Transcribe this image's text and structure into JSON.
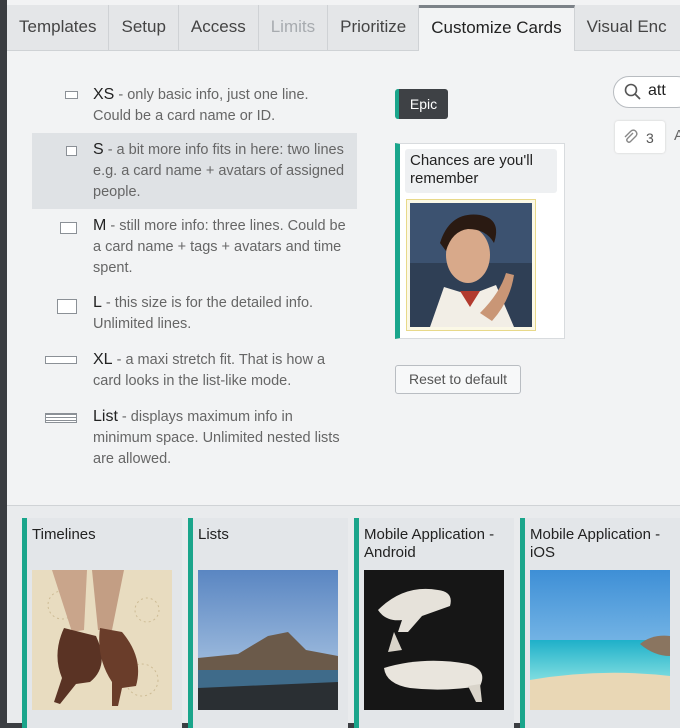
{
  "tabs": [
    {
      "label": "Templates",
      "state": "normal"
    },
    {
      "label": "Setup",
      "state": "normal"
    },
    {
      "label": "Access",
      "state": "normal"
    },
    {
      "label": "Limits",
      "state": "disabled"
    },
    {
      "label": "Prioritize",
      "state": "normal"
    },
    {
      "label": "Customize Cards",
      "state": "active"
    },
    {
      "label": "Visual Enc",
      "state": "normal"
    }
  ],
  "sizes": [
    {
      "code": "XS",
      "desc": " - only basic info, just one line. Could be a card name or ID."
    },
    {
      "code": "S",
      "desc": " - a bit more info fits in here: two lines e.g. a card name + avatars of assigned people."
    },
    {
      "code": "M",
      "desc": " - still more info: three lines. Could be a card name + tags + avatars and time spent."
    },
    {
      "code": "L",
      "desc": " - this size is for the detailed info. Unlimited lines."
    },
    {
      "code": "XL",
      "desc": " - a maxi stretch fit. That is how a card looks in the list-like mode."
    },
    {
      "code": "List",
      "desc": " - displays maximum info in minimum space. Unlimited nested lists are allowed."
    }
  ],
  "preview": {
    "tag": "Epic",
    "card_title": "Chances are you'll remember",
    "reset_label": "Reset to default"
  },
  "search": {
    "value": "att"
  },
  "attachments": {
    "count": "3",
    "trailing": "A"
  },
  "board_cards": [
    {
      "title": "Timelines"
    },
    {
      "title": "Lists"
    },
    {
      "title": "Mobile Application - Android"
    },
    {
      "title": "Mobile Application - iOS"
    }
  ],
  "colors": {
    "accent": "#1aa58b",
    "epic_bg": "#3e4145",
    "selected_row": "#dfe2e5"
  }
}
